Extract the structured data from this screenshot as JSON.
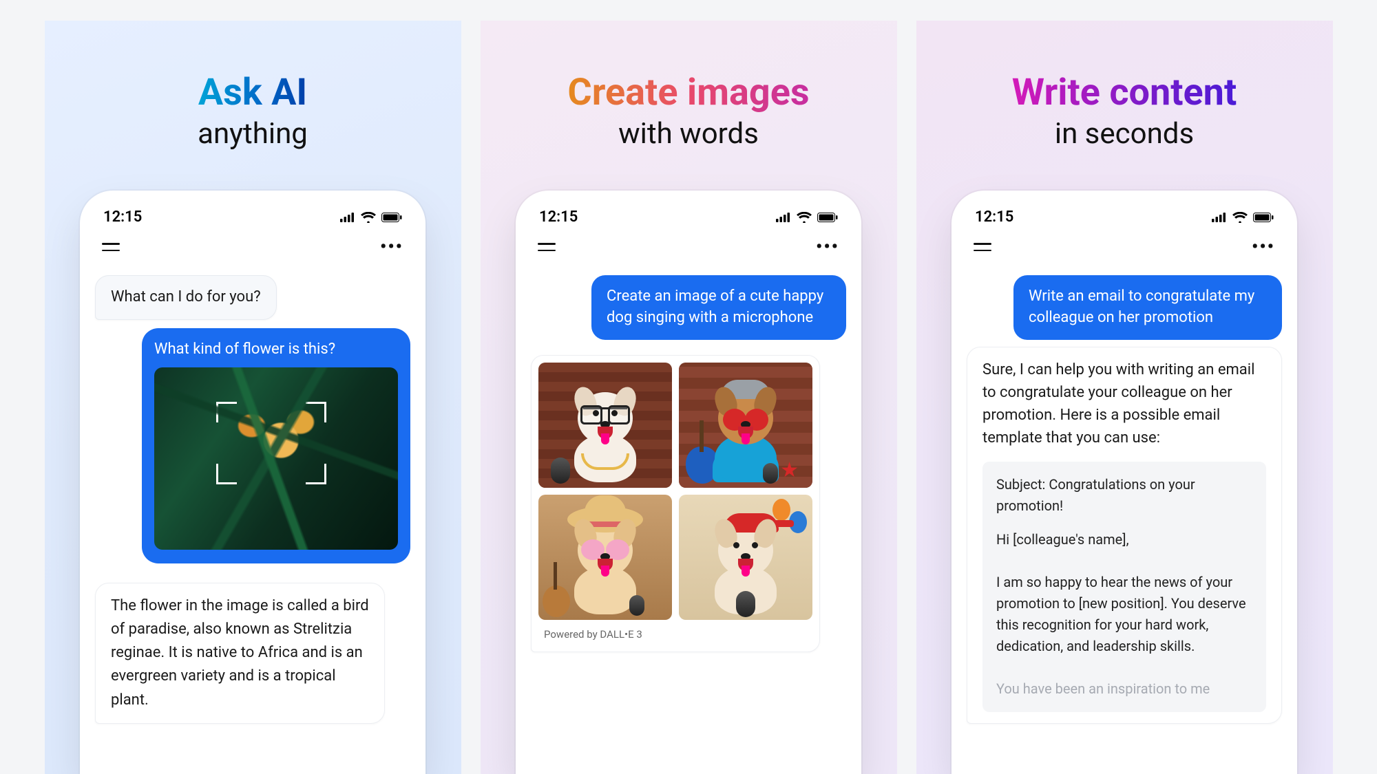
{
  "statusbar": {
    "time": "12:15"
  },
  "panel1": {
    "headline": "Ask AI",
    "subline": "anything",
    "ai_greeting": "What can I do for you?",
    "user_question": "What kind of flower is this?",
    "ai_answer": "The flower in the image is called a bird of paradise, also known as Strelitzia reginae. It is native to Africa and is an evergreen variety and is a tropical plant."
  },
  "panel2": {
    "headline": "Create images",
    "subline": "with words",
    "user_prompt": "Create an image of a cute happy dog singing with a microphone",
    "powered": "Powered by DALL•E 3"
  },
  "panel3": {
    "headline": "Write content",
    "subline": "in seconds",
    "user_prompt": "Write an email to congratulate my colleague on her promotion",
    "ai_intro": "Sure, I can help you with writing an email to congratulate your colleague on her promotion. Here is a possible email template that you can use:",
    "email": {
      "subject": "Subject: Congratulations on your promotion!",
      "greeting": "Hi [colleague's name],",
      "body": "I am so happy to hear the news of your promotion to [new position]. You deserve this recognition for your hard work, dedication, and leadership skills.",
      "fade": "You have been an inspiration to me"
    }
  }
}
